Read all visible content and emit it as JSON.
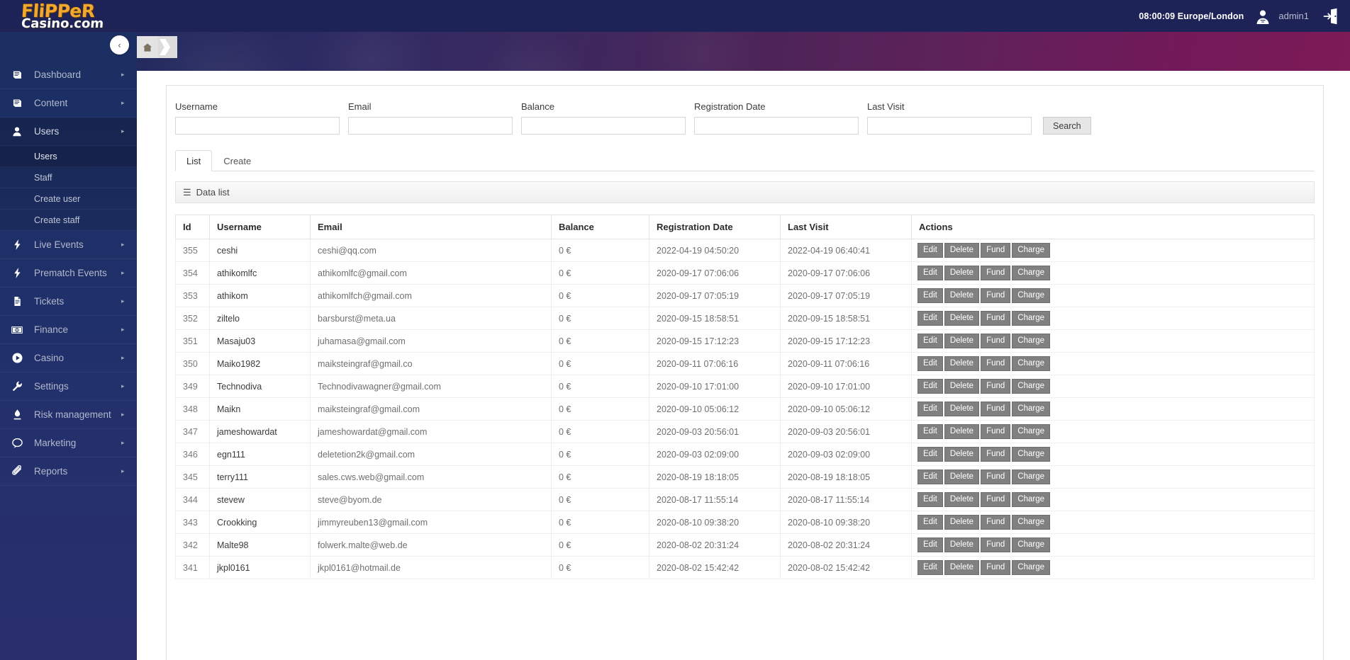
{
  "brand": {
    "logo_top": "FliPPeR",
    "logo_bottom": "Casino.com"
  },
  "topbar": {
    "clock": "08:00:09 Europe/London",
    "username": "admin1",
    "avatar_icon": "user-avatar-icon",
    "logout_icon": "logout-door-icon"
  },
  "breadcrumb": {
    "home_icon": "home-icon",
    "collapse_icon": "chevron-left-icon"
  },
  "sidebar": {
    "items": [
      {
        "label": "Dashboard",
        "icon": "book-icon",
        "caret": "▸",
        "active": false
      },
      {
        "label": "Content",
        "icon": "book-icon",
        "caret": "▸",
        "active": false
      },
      {
        "label": "Users",
        "icon": "user-icon",
        "caret": "▸",
        "active": true
      },
      {
        "label": "Live Events",
        "icon": "bolt-icon",
        "caret": "▸",
        "active": false
      },
      {
        "label": "Prematch Events",
        "icon": "bolt-icon",
        "caret": "▸",
        "active": false
      },
      {
        "label": "Tickets",
        "icon": "document-icon",
        "caret": "▸",
        "active": false
      },
      {
        "label": "Finance",
        "icon": "banknote-icon",
        "caret": "▸",
        "active": false
      },
      {
        "label": "Casino",
        "icon": "play-circle-icon",
        "caret": "▸",
        "active": false
      },
      {
        "label": "Settings",
        "icon": "wrench-icon",
        "caret": "▸",
        "active": false
      },
      {
        "label": "Risk management",
        "icon": "flame-icon",
        "caret": "▸",
        "active": false
      },
      {
        "label": "Marketing",
        "icon": "speech-bubble-icon",
        "caret": "▸",
        "active": false
      },
      {
        "label": "Reports",
        "icon": "paperclip-icon",
        "caret": "▸",
        "active": false
      }
    ],
    "users_submenu": [
      {
        "label": "Users",
        "active": true
      },
      {
        "label": "Staff",
        "active": false
      },
      {
        "label": "Create user",
        "active": false
      },
      {
        "label": "Create staff",
        "active": false
      }
    ]
  },
  "filters": {
    "fields": [
      {
        "label": "Username",
        "value": "",
        "placeholder": ""
      },
      {
        "label": "Email",
        "value": "",
        "placeholder": ""
      },
      {
        "label": "Balance",
        "value": "",
        "placeholder": ""
      },
      {
        "label": "Registration Date",
        "value": "",
        "placeholder": ""
      },
      {
        "label": "Last Visit",
        "value": "",
        "placeholder": ""
      }
    ],
    "search_label": "Search"
  },
  "tabs": [
    {
      "label": "List",
      "active": true
    },
    {
      "label": "Create",
      "active": false
    }
  ],
  "panel": {
    "datalist_title": "Data list",
    "hamburger": "☰"
  },
  "table": {
    "columns": [
      "Id",
      "Username",
      "Email",
      "Balance",
      "Registration Date",
      "Last Visit",
      "Actions"
    ],
    "action_labels": [
      "Edit",
      "Delete",
      "Fund",
      "Charge"
    ],
    "rows": [
      {
        "id": "355",
        "username": "ceshi",
        "email": "ceshi@qq.com",
        "balance": "0 €",
        "registration": "2022-04-19 04:50:20",
        "last_visit": "2022-04-19 06:40:41"
      },
      {
        "id": "354",
        "username": "athikomlfc",
        "email": "athikomlfc@gmail.com",
        "balance": "0 €",
        "registration": "2020-09-17 07:06:06",
        "last_visit": "2020-09-17 07:06:06"
      },
      {
        "id": "353",
        "username": "athikom",
        "email": "athikomlfch@gmail.com",
        "balance": "0 €",
        "registration": "2020-09-17 07:05:19",
        "last_visit": "2020-09-17 07:05:19"
      },
      {
        "id": "352",
        "username": "ziltelo",
        "email": "barsburst@meta.ua",
        "balance": "0 €",
        "registration": "2020-09-15 18:58:51",
        "last_visit": "2020-09-15 18:58:51"
      },
      {
        "id": "351",
        "username": "Masaju03",
        "email": "juhamasa@gmail.com",
        "balance": "0 €",
        "registration": "2020-09-15 17:12:23",
        "last_visit": "2020-09-15 17:12:23"
      },
      {
        "id": "350",
        "username": "Maiko1982",
        "email": "maiksteingraf@gmail.co",
        "balance": "0 €",
        "registration": "2020-09-11 07:06:16",
        "last_visit": "2020-09-11 07:06:16"
      },
      {
        "id": "349",
        "username": "Technodiva",
        "email": "Technodivawagner@gmail.com",
        "balance": "0 €",
        "registration": "2020-09-10 17:01:00",
        "last_visit": "2020-09-10 17:01:00"
      },
      {
        "id": "348",
        "username": "Maikn",
        "email": "maiksteingraf@gmail.com",
        "balance": "0 €",
        "registration": "2020-09-10 05:06:12",
        "last_visit": "2020-09-10 05:06:12"
      },
      {
        "id": "347",
        "username": "jameshowardat",
        "email": "jameshowardat@gmail.com",
        "balance": "0 €",
        "registration": "2020-09-03 20:56:01",
        "last_visit": "2020-09-03 20:56:01"
      },
      {
        "id": "346",
        "username": "egn111",
        "email": "deletetion2k@gmail.com",
        "balance": "0 €",
        "registration": "2020-09-03 02:09:00",
        "last_visit": "2020-09-03 02:09:00"
      },
      {
        "id": "345",
        "username": "terry111",
        "email": "sales.cws.web@gmail.com",
        "balance": "0 €",
        "registration": "2020-08-19 18:18:05",
        "last_visit": "2020-08-19 18:18:05"
      },
      {
        "id": "344",
        "username": "stevew",
        "email": "steve@byom.de",
        "balance": "0 €",
        "registration": "2020-08-17 11:55:14",
        "last_visit": "2020-08-17 11:55:14"
      },
      {
        "id": "343",
        "username": "Crookking",
        "email": "jimmyreuben13@gmail.com",
        "balance": "0 €",
        "registration": "2020-08-10 09:38:20",
        "last_visit": "2020-08-10 09:38:20"
      },
      {
        "id": "342",
        "username": "Malte98",
        "email": "folwerk.malte@web.de",
        "balance": "0 €",
        "registration": "2020-08-02 20:31:24",
        "last_visit": "2020-08-02 20:31:24"
      },
      {
        "id": "341",
        "username": "jkpl0161",
        "email": "jkpl0161@hotmail.de",
        "balance": "0 €",
        "registration": "2020-08-02 15:42:42",
        "last_visit": "2020-08-02 15:42:42"
      }
    ]
  },
  "colors": {
    "topbar": "#1e2357",
    "sidebar": "#1b3063",
    "brand_orange": "#f0a830",
    "banner_start": "#232a5e",
    "banner_end": "#7c1b56",
    "action_button": "#808080"
  }
}
